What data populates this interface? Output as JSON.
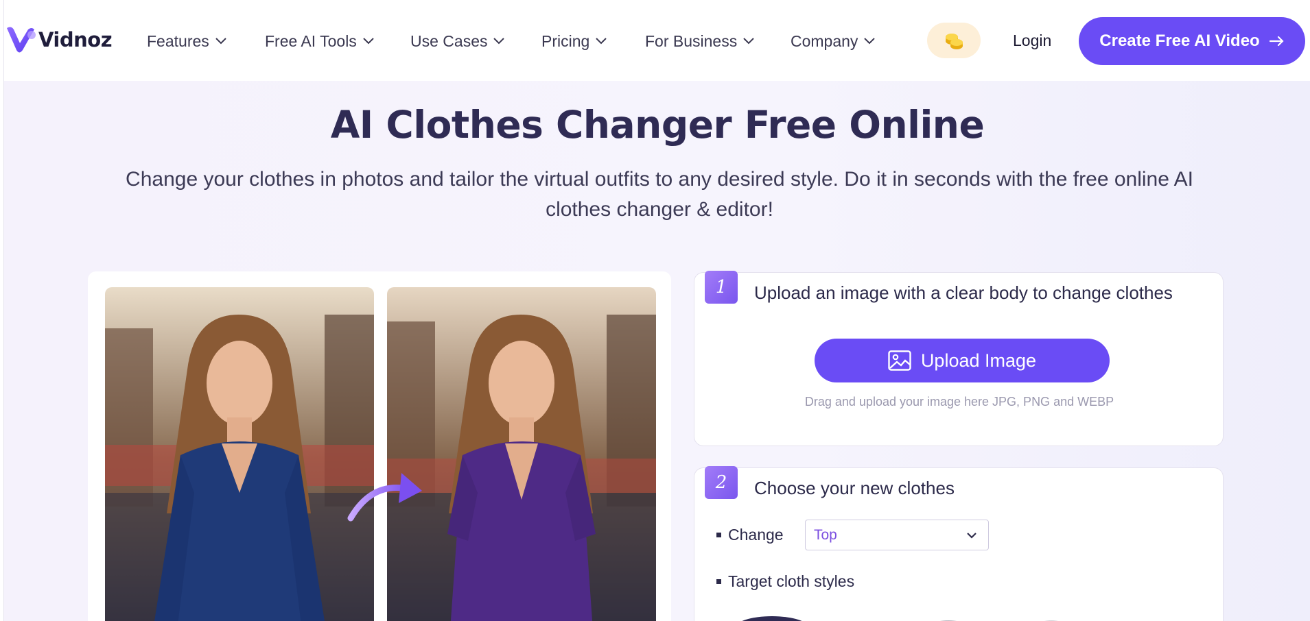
{
  "brand": {
    "name": "Vidnoz",
    "accent": "#6a4cf5",
    "title_color": "#2f2b54"
  },
  "nav": {
    "items": [
      {
        "label": "Features"
      },
      {
        "label": "Free AI Tools"
      },
      {
        "label": "Use Cases"
      },
      {
        "label": "Pricing"
      },
      {
        "label": "For Business"
      },
      {
        "label": "Company"
      }
    ],
    "coin_icon": "coins-icon",
    "login_label": "Login",
    "cta_label": "Create Free AI Video",
    "cta_icon": "arrow-right-icon"
  },
  "hero": {
    "title": "AI Clothes Changer Free Online",
    "subtitle": "Change your clothes in photos and tailor the virtual outfits to any desired style. Do it in seconds with the free online AI clothes changer & editor!"
  },
  "preview": {
    "before_outfit_color": "#1f3a78",
    "after_outfit_color": "#4e2a86",
    "arrow_icon": "curved-arrow-icon"
  },
  "step1": {
    "number": "1",
    "title": "Upload an image with a clear body to change clothes",
    "upload_label": "Upload Image",
    "upload_icon": "image-icon",
    "hint": "Drag and upload your image here JPG, PNG and WEBP"
  },
  "step2": {
    "number": "2",
    "title": "Choose your new clothes",
    "change_label": "Change",
    "change_value": "Top",
    "styles_label": "Target cloth styles"
  }
}
